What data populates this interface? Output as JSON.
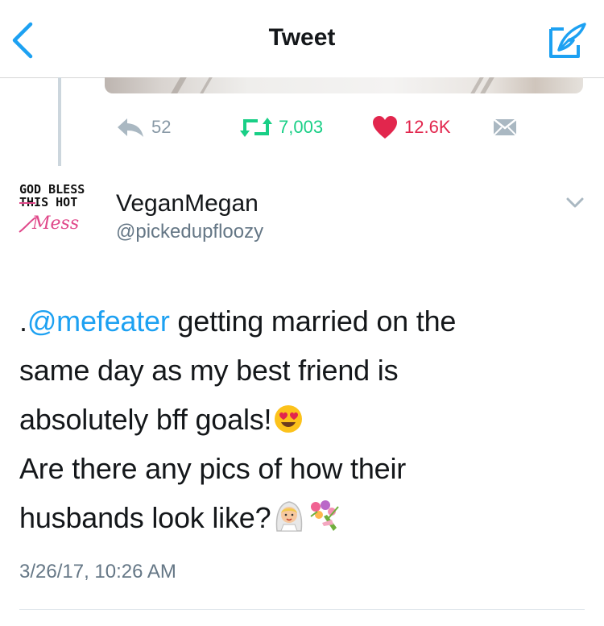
{
  "nav": {
    "title": "Tweet",
    "back_icon": "chevron-left-icon",
    "compose_icon": "compose-tweet-icon",
    "accent": "#1da1f2"
  },
  "previous_tweet": {
    "replies": "52",
    "retweets": "7,003",
    "likes": "12.6K"
  },
  "tweet": {
    "avatar_text": {
      "line1": "GOD BLESS",
      "line2": "THIS HOT",
      "line3": "Mess"
    },
    "display_name": "VeganMegan",
    "handle": "@pickedupfloozy",
    "text": {
      "prefix": ".",
      "mention": "@mefeater",
      "line1_rest": " getting married on the",
      "line2": "same day as my best friend is",
      "line3": "absolutely bff goals!",
      "line4": "Are there any pics of how their",
      "line5": "husbands look like?"
    },
    "emojis": [
      "heart-eyes-emoji",
      "bride-emoji",
      "bouquet-emoji"
    ],
    "timestamp": "3/26/17, 10:26 AM"
  },
  "colors": {
    "retweet": "#19cf86",
    "like": "#e2264d",
    "muted": "#8899a6"
  }
}
